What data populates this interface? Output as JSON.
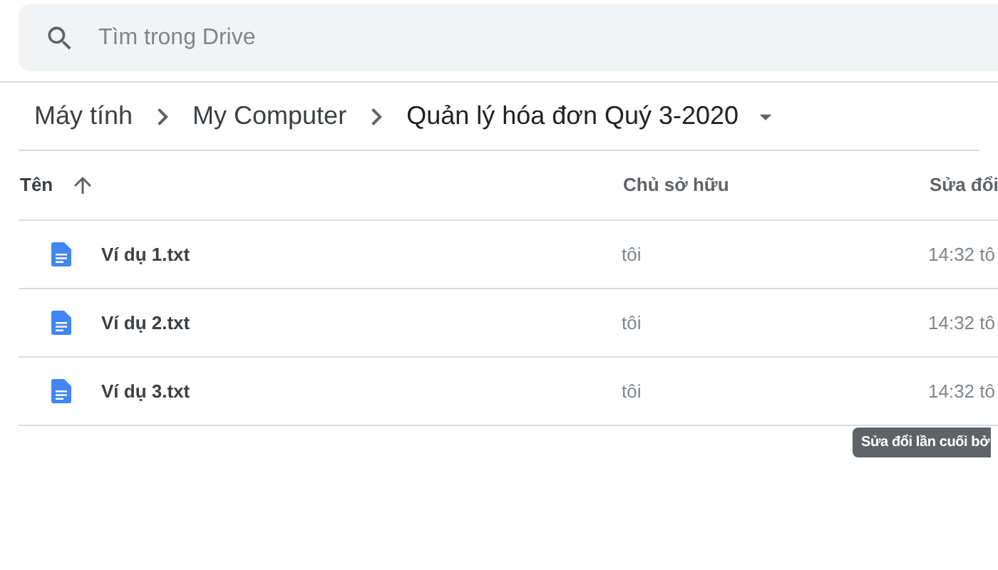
{
  "search": {
    "placeholder": "Tìm trong Drive"
  },
  "breadcrumb": [
    {
      "label": "Máy tính",
      "current": false
    },
    {
      "label": "My Computer",
      "current": false
    },
    {
      "label": "Quản lý hóa đơn Quý 3-2020",
      "current": true
    }
  ],
  "table": {
    "columns": [
      {
        "label": "Tên",
        "sorted": true
      },
      {
        "label": "Chủ sở hữu",
        "sorted": false
      },
      {
        "label": "Sửa đổi",
        "sorted": false
      }
    ],
    "rows": [
      {
        "name": "Ví dụ 1.txt",
        "owner": "tôi",
        "modified": "14:32 tô"
      },
      {
        "name": "Ví dụ 2.txt",
        "owner": "tôi",
        "modified": "14:32 tô"
      },
      {
        "name": "Ví dụ 3.txt",
        "owner": "tôi",
        "modified": "14:32 tô"
      }
    ]
  },
  "tooltip": "Sửa đổi lần cuối bở"
}
